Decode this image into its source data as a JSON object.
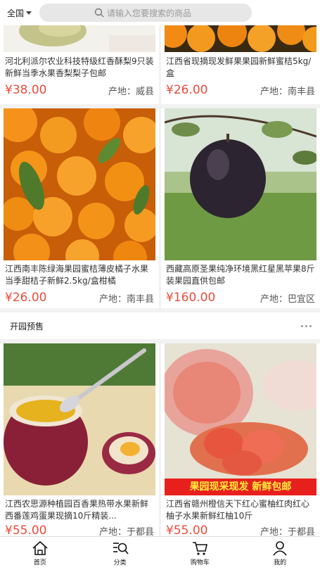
{
  "header": {
    "region_label": "全国",
    "search_placeholder": "请输入您要搜索的商品"
  },
  "products_top": [
    {
      "title": "河北利派尔农业科技特级红香酥梨9只装新鲜当季水果香梨梨子包邮",
      "price": "¥38.00",
      "origin": "产地：威县"
    },
    {
      "title": "江西省现摘现发鲜果果园新鲜蜜桔5kg/盒",
      "price": "¥26.00",
      "origin": "产地：南丰县"
    },
    {
      "title": "江西南丰陈绿海果园蜜桔薄皮橘子水果当季甜桔子新鲜2.5kg/盒柑橘",
      "price": "¥26.00",
      "origin": "产地：南丰县"
    },
    {
      "title": "西藏高原圣果纯净环境黑红星黑苹果8斤装果园直供包邮",
      "price": "¥160.00",
      "origin": "产地：巴宜区"
    }
  ],
  "section": {
    "title": "开园预售"
  },
  "products_bottom": [
    {
      "title": "江西农思源种植园百香果热带水果新鲜西番莲鸡蛋果现摘10斤精装...",
      "price": "¥55.00",
      "origin": "产地：于都县"
    },
    {
      "title": "江西省赣州橙信天下红心蜜柚红肉红心柚子水果新鲜红柚10斤",
      "price": "¥55.00",
      "origin": "产地：于都县"
    }
  ],
  "banner_text": "果园现采现发 新鲜包邮",
  "nav": [
    {
      "label": "首页",
      "icon": "home-icon"
    },
    {
      "label": "分类",
      "icon": "category-search-icon"
    },
    {
      "label": "购物车",
      "icon": "cart-icon"
    },
    {
      "label": "我的",
      "icon": "user-icon"
    }
  ],
  "colors": {
    "price": "#e84c3d",
    "banner": "#e8201d",
    "banner_text": "#ffef3b"
  }
}
